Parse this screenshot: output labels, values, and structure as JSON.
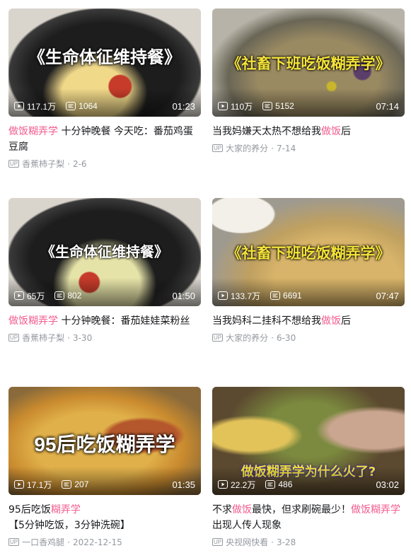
{
  "cards": [
    {
      "overlay": "《生命体征维持餐》",
      "views": "117.1万",
      "danmaku": "1064",
      "duration": "01:23",
      "title_parts": [
        {
          "t": "做饭糊弄学",
          "hl": true
        },
        {
          "t": " 十分钟晚餐 今天吃：番茄鸡蛋豆腐",
          "hl": false
        }
      ],
      "author": "香蕉柿子梨",
      "date": "2-6"
    },
    {
      "overlay": "《社畜下班吃饭糊弄学》",
      "views": "110万",
      "danmaku": "5152",
      "duration": "07:14",
      "title_parts": [
        {
          "t": "当我妈嫌天太热不想给我",
          "hl": false
        },
        {
          "t": "做饭",
          "hl": true
        },
        {
          "t": "后",
          "hl": false
        }
      ],
      "author": "大家的养分",
      "date": "7-14"
    },
    {
      "overlay": "《生命体征维持餐》",
      "views": "65万",
      "danmaku": "802",
      "duration": "01:50",
      "title_parts": [
        {
          "t": "做饭糊弄学",
          "hl": true
        },
        {
          "t": " 十分钟晚餐：番茄娃娃菜粉丝",
          "hl": false
        }
      ],
      "author": "香蕉柿子梨",
      "date": "3-30"
    },
    {
      "overlay": "《社畜下班吃饭糊弄学》",
      "views": "133.7万",
      "danmaku": "6691",
      "duration": "07:47",
      "title_parts": [
        {
          "t": "当我妈科二挂科不想给我",
          "hl": false
        },
        {
          "t": "做饭",
          "hl": true
        },
        {
          "t": "后",
          "hl": false
        }
      ],
      "author": "大家的养分",
      "date": "6-30"
    },
    {
      "overlay": "95后吃饭糊弄学",
      "views": "17.1万",
      "danmaku": "207",
      "duration": "01:35",
      "title_parts": [
        {
          "t": "95后吃饭",
          "hl": false
        },
        {
          "t": "糊弄学",
          "hl": true
        },
        {
          "t": "【5分钟吃饭，3分钟洗碗】",
          "hl": false
        }
      ],
      "author": "一口香鸡腿",
      "date": "2022-12-15"
    },
    {
      "overlay": "做饭糊弄学为什么火了?",
      "views": "22.2万",
      "danmaku": "486",
      "duration": "03:02",
      "title_parts": [
        {
          "t": "不求",
          "hl": false
        },
        {
          "t": "做饭",
          "hl": true
        },
        {
          "t": "最快，但求刷碗最少！",
          "hl": false
        },
        {
          "t": "做饭糊弄学",
          "hl": true
        },
        {
          "t": "出现人传人现象",
          "hl": false
        }
      ],
      "author": "央视网快看",
      "date": "3-28"
    }
  ],
  "labels": {
    "up_badge": "UP",
    "separator": "·"
  },
  "colors": {
    "highlight": "#f25d8e",
    "meta": "#9499a0",
    "title": "#18191c"
  },
  "icons": {
    "views": "play-count-icon",
    "danmaku": "danmaku-count-icon"
  }
}
